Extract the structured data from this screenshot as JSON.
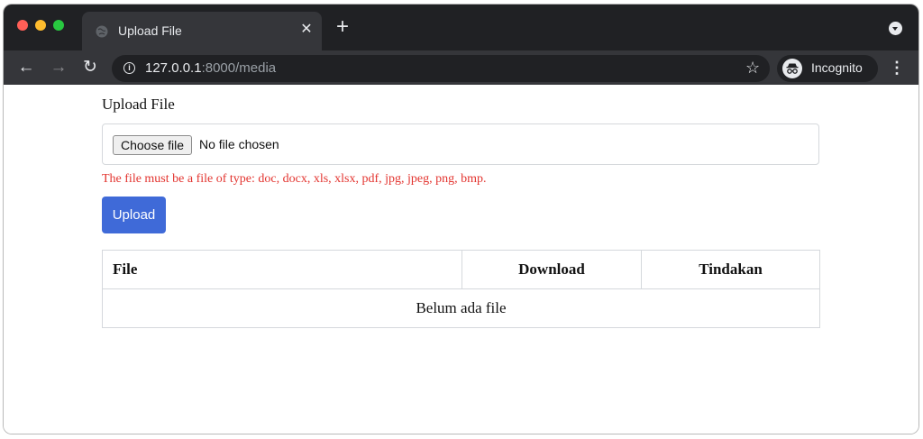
{
  "browser": {
    "tab_title": "Upload File",
    "url_host": "127.0.0.1",
    "url_rest": ":8000/media",
    "incognito_label": "Incognito"
  },
  "page": {
    "heading": "Upload File",
    "choose_file_label": "Choose file",
    "no_file_text": "No file chosen",
    "error_message": "The file must be a file of type: doc, docx, xls, xlsx, pdf, jpg, jpeg, png, bmp.",
    "upload_label": "Upload",
    "table": {
      "headers": [
        "File",
        "Download",
        "Tindakan"
      ],
      "empty_text": "Belum ada file"
    }
  },
  "colors": {
    "error": "#e3342f",
    "primary": "#3f6ad8"
  }
}
